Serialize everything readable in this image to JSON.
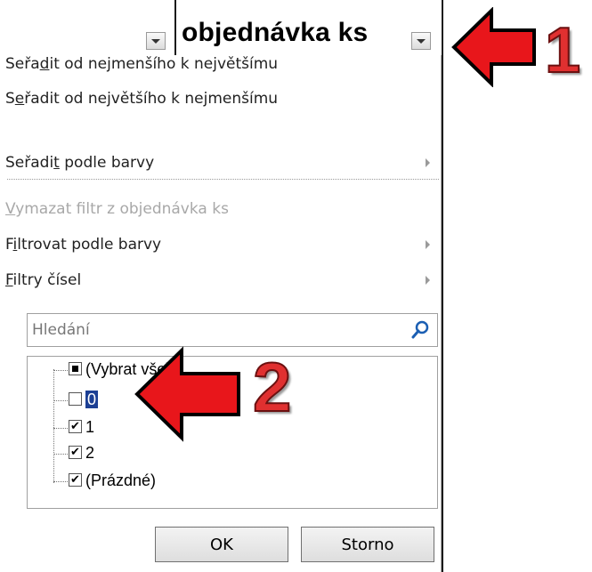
{
  "header": {
    "title": "objednávka ks"
  },
  "menu": {
    "sort_asc": {
      "pre": "Seřa",
      "acc": "d",
      "post": "it od nejmenšího k největšímu"
    },
    "sort_desc": {
      "pre": "S",
      "acc": "e",
      "post": "řadit od největšího k nejmenšímu"
    },
    "sort_color": {
      "pre": "Seřadi",
      "acc": "t",
      "post": " podle barvy"
    },
    "clear_filter": {
      "pre": "",
      "acc": "V",
      "post": "ymazat filtr z objednávka ks"
    },
    "filter_color": {
      "pre": "F",
      "acc": "i",
      "post": "ltrovat podle barvy"
    },
    "number_filters": {
      "pre": "",
      "acc": "F",
      "post": "iltry čísel"
    }
  },
  "search": {
    "placeholder": "Hledání"
  },
  "tree": [
    {
      "label": "(Vybrat vše)",
      "state": "partial"
    },
    {
      "label": "0",
      "state": "unchecked"
    },
    {
      "label": "1",
      "state": "checked"
    },
    {
      "label": "2",
      "state": "checked"
    },
    {
      "label": "(Prázdné)",
      "state": "checked"
    }
  ],
  "buttons": {
    "ok": "OK",
    "cancel": "Storno"
  },
  "annotations": {
    "callout_1": "1",
    "callout_2": "2"
  },
  "colors": {
    "arrow_red": "#e8161b",
    "selection": "#1c3f94",
    "callout_red": "#e03030"
  },
  "icons": [
    "chevron-down-icon",
    "search-icon",
    "submenu-arrow-icon",
    "checkbox-icon",
    "red-arrow-icon"
  ]
}
